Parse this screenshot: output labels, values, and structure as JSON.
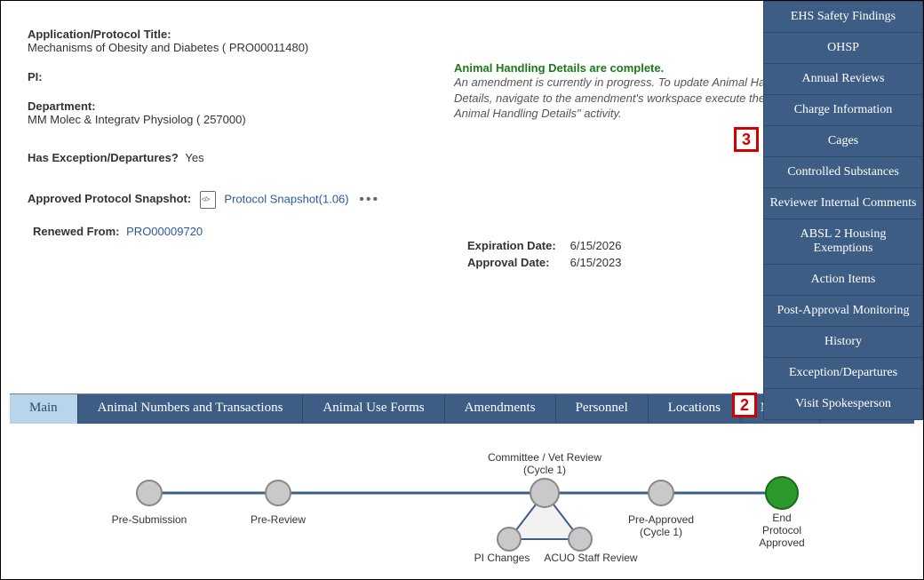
{
  "header": {
    "title_label": "Application/Protocol Title:",
    "title_value": "Mechanisms of Obesity and Diabetes ( PRO00011480)",
    "pi_label": "PI:",
    "pi_value": "",
    "dept_label": "Department:",
    "dept_value": "MM Molec & Integratv Physiolog ( 257000)",
    "exception_label": "Has Exception/Departures?",
    "exception_value": "Yes"
  },
  "status": {
    "complete_text": "Animal Handling Details are complete.",
    "note_text": "An amendment is currently in progress. To update Animal Handling Details, navigate to the amendment's workspace execute the \"Update Animal Handling Details\" activity."
  },
  "snapshot": {
    "label": "Approved Protocol Snapshot:",
    "link_text": "Protocol Snapshot(1.06)",
    "renewed_label": "Renewed From:",
    "renewed_link": "PRO00009720"
  },
  "dates": {
    "expiration_label": "Expiration Date:",
    "expiration_value": "6/15/2026",
    "approval_label": "Approval Date:",
    "approval_value": "6/15/2023"
  },
  "tabs": {
    "main": "Main",
    "animal_numbers": "Animal Numbers and Transactions",
    "use_forms": "Animal Use Forms",
    "amendments": "Amendments",
    "personnel": "Personnel",
    "locations": "Locations",
    "more": "More..."
  },
  "dropdown_items": [
    "EHS Safety Findings",
    "OHSP",
    "Annual Reviews",
    "Charge Information",
    "Cages",
    "Controlled Substances",
    "Reviewer Internal Comments",
    "ABSL 2 Housing Exemptions",
    "Action Items",
    "Post-Approval Monitoring",
    "History",
    "Exception/Departures",
    "Visit Spokesperson"
  ],
  "workflow": {
    "nodes": [
      {
        "label": "Pre-Submission"
      },
      {
        "label": "Pre-Review"
      },
      {
        "label": "Committee / Vet Review\n(Cycle 1)"
      },
      {
        "label": "PI Changes"
      },
      {
        "label": "ACUO Staff Review"
      },
      {
        "label": "Pre-Approved\n(Cycle 1)"
      },
      {
        "label": "End\nProtocol\nApproved"
      }
    ]
  },
  "callouts": {
    "two": "2",
    "three": "3"
  }
}
